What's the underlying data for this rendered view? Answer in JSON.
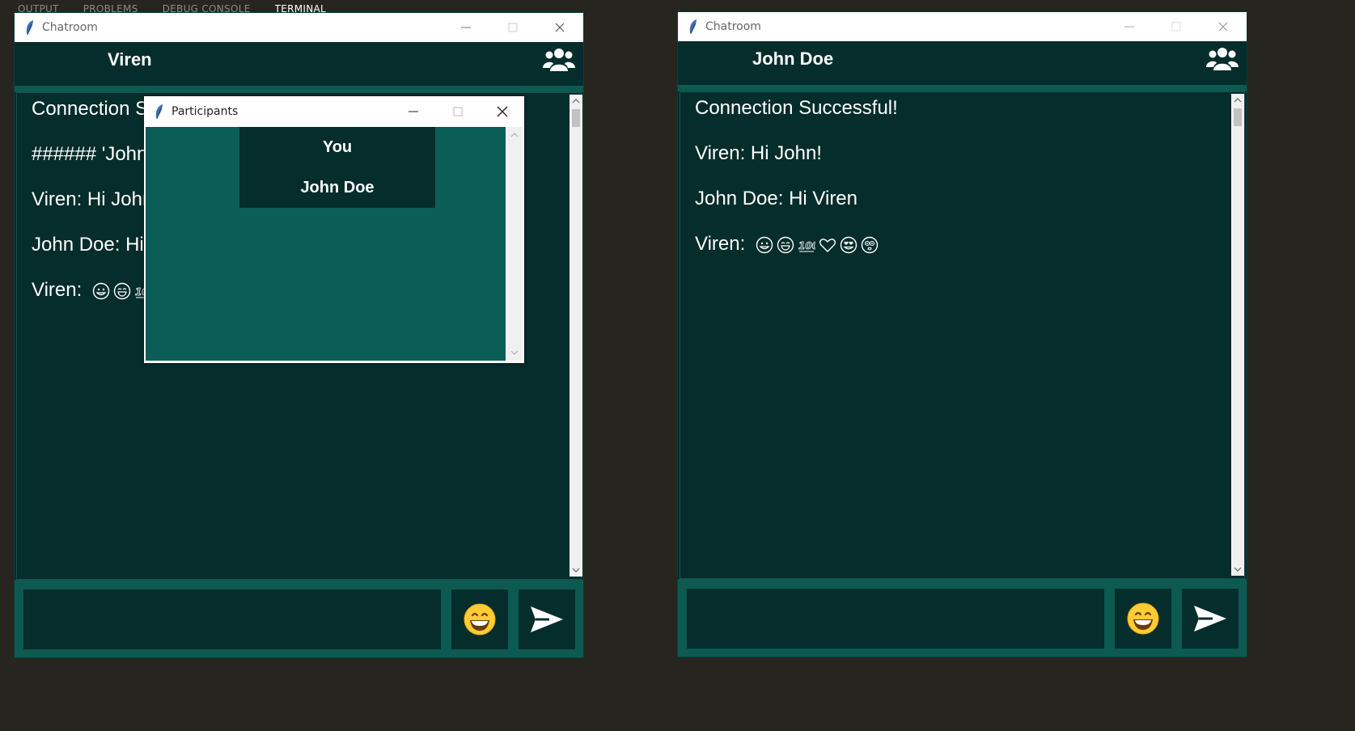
{
  "panel_tabs": [
    {
      "label": "OUTPUT",
      "active": false
    },
    {
      "label": "PROBLEMS",
      "active": false
    },
    {
      "label": "DEBUG CONSOLE",
      "active": false
    },
    {
      "label": "TERMINAL",
      "active": true
    }
  ],
  "windows": [
    {
      "title": "Chatroom",
      "username": "Viren",
      "messages": [
        {
          "text": "Connection S"
        },
        {
          "text": "###### 'John"
        },
        {
          "text": "Viren: Hi John"
        },
        {
          "text": "John Doe: Hi"
        },
        {
          "text": "Viren:",
          "emojis": [
            "grinning-face-icon",
            "grinning-squint-icon",
            "hundred-points-icon"
          ]
        }
      ]
    },
    {
      "title": "Chatroom",
      "username": "John Doe",
      "messages": [
        {
          "text": "Connection Successful!"
        },
        {
          "text": "Viren: Hi John!"
        },
        {
          "text": "John Doe: Hi Viren"
        },
        {
          "text": "Viren:",
          "emojis": [
            "grinning-face-icon",
            "grinning-squint-icon",
            "hundred-points-icon",
            "heart-icon",
            "heart-eyes-icon",
            "flushed-face-icon"
          ]
        }
      ]
    }
  ],
  "participants_popup": {
    "title": "Participants",
    "items": [
      "You",
      "John Doe"
    ]
  },
  "colors": {
    "background": "#26251f",
    "chat_bg": "#052d2b",
    "accent": "#0c5a52",
    "popup_bg": "#0a5e55"
  }
}
